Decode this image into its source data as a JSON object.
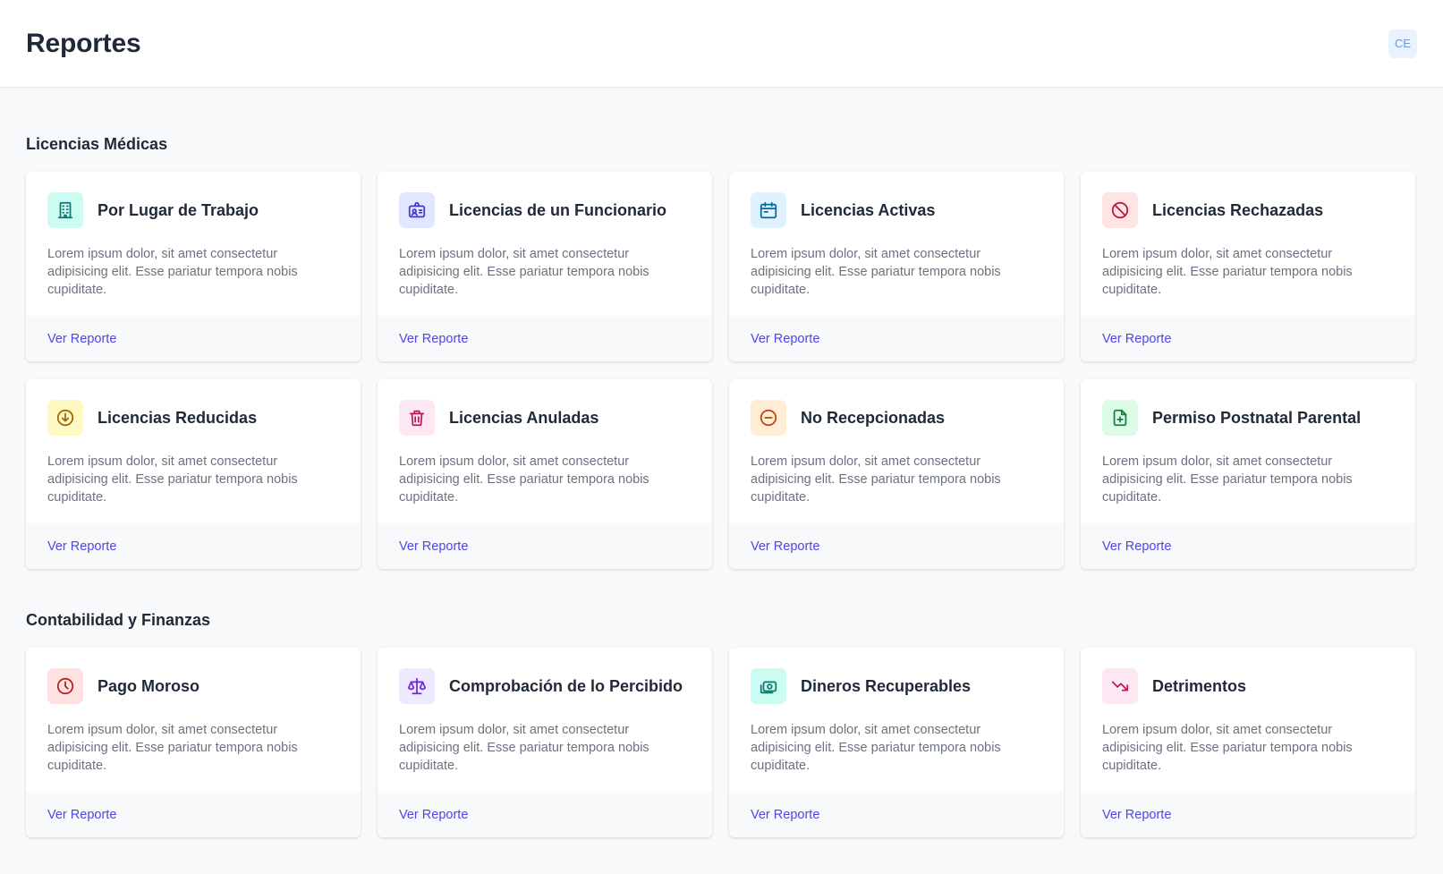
{
  "header": {
    "title": "Reportes",
    "avatar_initials": "CE"
  },
  "sections": [
    {
      "title": "Licencias Médicas",
      "cards": [
        {
          "title": "Por Lugar de Trabajo",
          "icon": "office-building-icon",
          "icon_color": "#0f766e",
          "icon_bg": "#ccfbf1"
        },
        {
          "title": "Licencias de un Funcionario",
          "icon": "identification-icon",
          "icon_color": "#4338ca",
          "icon_bg": "#e0e7ff"
        },
        {
          "title": "Licencias Activas",
          "icon": "calendar-icon",
          "icon_color": "#0369a1",
          "icon_bg": "#e0f2fe"
        },
        {
          "title": "Licencias Rechazadas",
          "icon": "ban-icon",
          "icon_color": "#be123c",
          "icon_bg": "#ffe4e6"
        },
        {
          "title": "Licencias Reducidas",
          "icon": "arrow-circle-down-icon",
          "icon_color": "#a16207",
          "icon_bg": "#fef9c3"
        },
        {
          "title": "Licencias Anuladas",
          "icon": "trash-icon",
          "icon_color": "#be185d",
          "icon_bg": "#fce7f3"
        },
        {
          "title": "No Recepcionadas",
          "icon": "minus-circle-icon",
          "icon_color": "#c2410c",
          "icon_bg": "#ffedd5"
        },
        {
          "title": "Permiso Postnatal Parental",
          "icon": "document-add-icon",
          "icon_color": "#15803d",
          "icon_bg": "#dcfce7"
        }
      ]
    },
    {
      "title": "Contabilidad y Finanzas",
      "cards": [
        {
          "title": "Pago Moroso",
          "icon": "clock-icon",
          "icon_color": "#b91c1c",
          "icon_bg": "#fee2e2"
        },
        {
          "title": "Comprobación de lo Percibido",
          "icon": "scale-icon",
          "icon_color": "#6d28d9",
          "icon_bg": "#ede9fe"
        },
        {
          "title": "Dineros Recuperables",
          "icon": "cash-icon",
          "icon_color": "#0f766e",
          "icon_bg": "#ccfbf1"
        },
        {
          "title": "Detrimentos",
          "icon": "trending-down-icon",
          "icon_color": "#be185d",
          "icon_bg": "#fce7f3"
        }
      ]
    }
  ],
  "card_description": "Lorem ipsum dolor, sit amet consectetur adipisicing elit. Esse pariatur tempora nobis cupiditate.",
  "card_link_label": "Ver Reporte"
}
